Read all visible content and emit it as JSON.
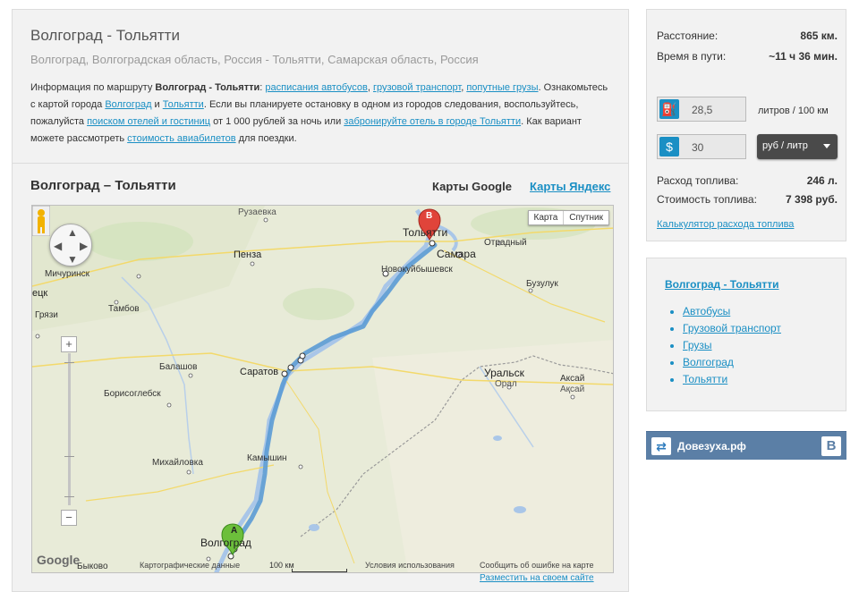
{
  "route": {
    "title": "Волгоград - Тольятти",
    "subtitle": "Волгоград, Волгоградская область, Россия - Тольятти, Самарская область, Россия",
    "info_prefix": "Информация по маршруту ",
    "info_route_bold": "Волгоград - Тольятти",
    "info_colon": ": ",
    "link_bus": "расписания автобусов",
    "sep1": ", ",
    "link_cargo": "грузовой транспорт",
    "sep2": ", ",
    "link_freight": "попутные грузы",
    "info_p2a": ". Ознакомьтесь с картой города ",
    "link_volgograd": "Волгоград",
    "info_and": " и ",
    "link_tolyatti": "Тольятти",
    "info_p2b": ". Если вы планируете остановку в одном из городов следования, воспользуйтесь, пожалуйста ",
    "link_hotels": "поиском отелей и гостиниц",
    "info_p2c": " от 1 000 рублей за ночь или ",
    "link_book": "забронируйте отель в городе Тольятти",
    "info_p2d": ". Как вариант можете рассмотреть ",
    "link_air": "стоимость авиабилетов",
    "info_p2e": " для поездки."
  },
  "map_section": {
    "title": "Волгоград – Тольятти",
    "google_maps": "Карты Google",
    "yandex_maps": "Карты Яндекс",
    "map_type_map": "Карта",
    "map_type_satellite": "Спутник",
    "labels": {
      "ruzaevka": "Рузаевка",
      "penza": "Пенза",
      "michurinsk": "Мичуринск",
      "tsk": "ецк",
      "tambov": "Тамбов",
      "gryazi": "Грязи",
      "balashov": "Балашов",
      "borisoglebsk": "Борисоглебск",
      "saratov": "Саратов",
      "mikhaylovka": "Михайловка",
      "kamyshin": "Камышин",
      "volgograd": "Волгоград",
      "tolyatti": "Тольятти",
      "samara": "Самара",
      "otradny": "Отрадный",
      "novokuybyshevsk": "Новокуйбышевск",
      "buzuluk": "Бузулук",
      "uralsk": "Уральск",
      "oral": "Орал",
      "aksay": "Аксай",
      "aksay_kz": "Ақсай",
      "bykovo": "Быково",
      "marker_a": "A",
      "marker_b": "B"
    },
    "google_logo": "Google",
    "attribution": "Картографические данные",
    "scale": "100 км",
    "terms": "Условия использования",
    "report": "Сообщить об ошибке на карте",
    "embed": "Разместить на своем сайте",
    "zoom_in": "+",
    "zoom_out": "−"
  },
  "calculator": {
    "distance_label": "Расстояние:",
    "distance_value": "865 км.",
    "time_label": "Время в пути:",
    "time_value": "~11 ч 36 мин.",
    "consumption_input": "28,5",
    "consumption_unit": "литров / 100 км",
    "price_input": "30",
    "currency_select": "руб / литр",
    "fuel_used_label": "Расход топлива:",
    "fuel_used_value": "246 л.",
    "fuel_cost_label": "Стоимость топлива:",
    "fuel_cost_value": "7 398 руб.",
    "calc_link": "Калькулятор расхода топлива"
  },
  "related": {
    "title": "Волгоград - Тольятти",
    "items": [
      "Автобусы",
      "Грузовой транспорт",
      "Грузы",
      "Волгоград",
      "Тольятти"
    ]
  },
  "vk_widget": {
    "name": "Довезуха.рф",
    "vk_letter": "В"
  },
  "colors": {
    "link": "#1a8fc4",
    "route_line": "#5b9bd5",
    "marker_a": "#6cbf3b",
    "marker_b": "#e0443a",
    "vk": "#5b7fa6"
  }
}
